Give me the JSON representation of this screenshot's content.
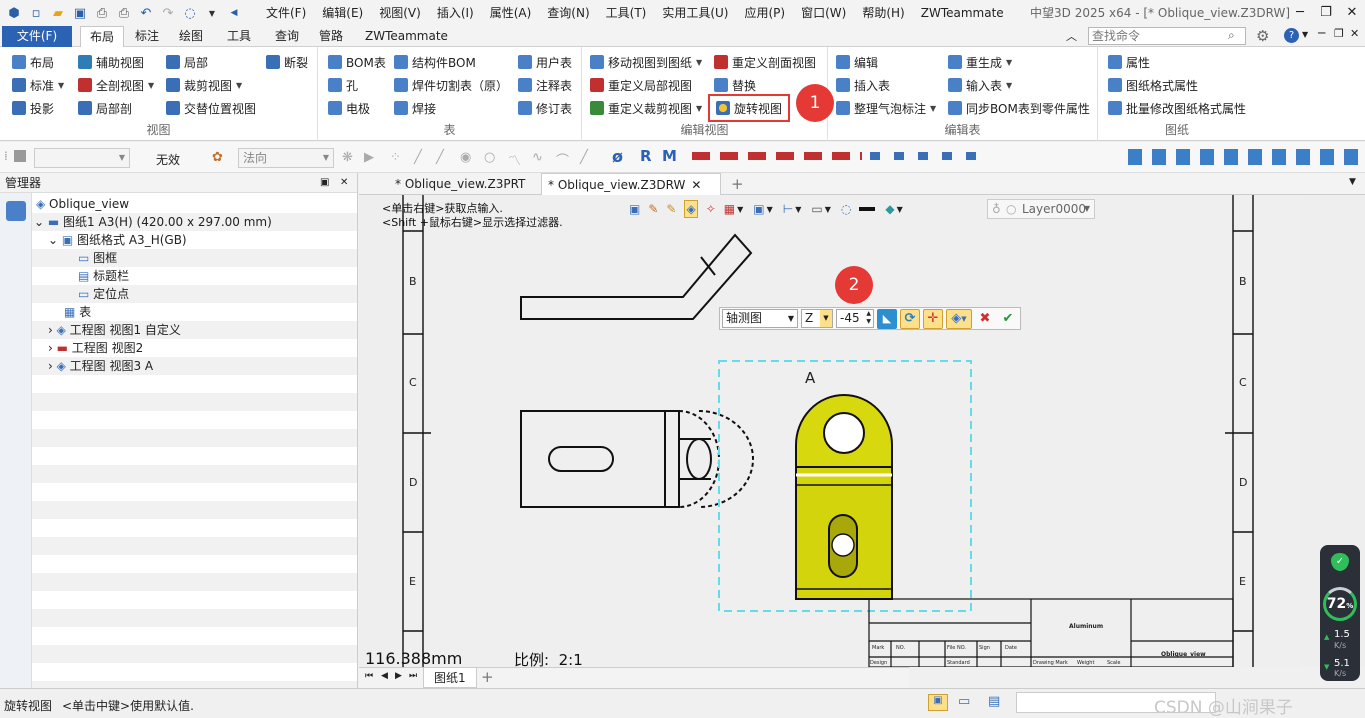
{
  "title_bar": {
    "menus": [
      "文件(F)",
      "编辑(E)",
      "视图(V)",
      "插入(I)",
      "属性(A)",
      "查询(N)",
      "工具(T)",
      "实用工具(U)",
      "应用(P)",
      "窗口(W)",
      "帮助(H)",
      "ZWTeammate"
    ],
    "title": "中望3D 2025 x64 - [* Oblique_view.Z3DRW]"
  },
  "ribbon_tabs": {
    "file": "文件(F)",
    "tabs": [
      "布局",
      "标注",
      "绘图",
      "工具",
      "查询",
      "管路",
      "ZWTeammate"
    ],
    "active": "布局",
    "search_placeholder": "查找命令"
  },
  "ribbon": {
    "view": {
      "name": "视图",
      "col1": [
        "布局",
        "标准",
        "投影"
      ],
      "col2": [
        "辅助视图",
        "全剖视图",
        "局部剖"
      ],
      "col3": [
        "局部",
        "裁剪视图",
        "交替位置视图"
      ],
      "col4": [
        "断裂"
      ]
    },
    "table": {
      "name": "表",
      "col1": [
        "BOM表",
        "孔",
        "电极"
      ],
      "col2": [
        "结构件BOM",
        "焊件切割表（原）",
        "焊接"
      ],
      "col3": [
        "用户表",
        "注释表",
        "修订表"
      ]
    },
    "edit_view": {
      "name": "编辑视图",
      "col1": [
        "移动视图到图纸",
        "重定义局部视图",
        "重定义裁剪视图"
      ],
      "col2": [
        "重定义剖面视图",
        "替换",
        "旋转视图"
      ]
    },
    "edit_table": {
      "name": "编辑表",
      "col1": [
        "编辑",
        "插入表",
        "整理气泡标注"
      ],
      "col2": [
        "重生成",
        "输入表",
        "同步BOM表到零件属性"
      ]
    },
    "sheet": {
      "name": "图纸",
      "items": [
        "属性",
        "图纸格式属性",
        "批量修改图纸格式属性"
      ]
    }
  },
  "toolbar2": {
    "invalid": "无效",
    "normal": "法向",
    "tools": [
      "ø",
      "R",
      "M"
    ]
  },
  "manager": {
    "title": "管理器",
    "tree": [
      "Oblique_view",
      "图纸1 A3(H) (420.00 x 297.00 mm)",
      "图纸格式 A3_H(GB)",
      "图框",
      "标题栏",
      "定位点",
      "表",
      "工程图 视图1 自定义",
      "工程图 视图2",
      "工程图 视图3 A"
    ]
  },
  "doc_tabs": [
    "* Oblique_view.Z3PRT",
    "* Oblique_view.Z3DRW"
  ],
  "canvas": {
    "hint1": "<单击右键>获取点输入.",
    "hint2": "<Shift +鼠标右键>显示选择过滤器.",
    "layer": "Layer0000",
    "border_left": [
      "B",
      "C",
      "D",
      "E"
    ],
    "border_right": [
      "B",
      "C",
      "D",
      "E"
    ],
    "view_label": "A",
    "coord": "116.388mm",
    "scale_label": "比例:",
    "scale_value": "2:1",
    "title_block": {
      "material": "Aluminum",
      "file_name": "Oblique_view",
      "headers": [
        "Mark",
        "NO.",
        "File NO.",
        "Sign",
        "Date"
      ],
      "row2": [
        "Design",
        "Standard",
        "Drawing Mark",
        "Weight",
        "Scale"
      ]
    }
  },
  "float_bar": {
    "view_type": "轴测图",
    "axis": "Z",
    "angle": "-45"
  },
  "callouts": [
    "1",
    "2"
  ],
  "sheet_tab": "图纸1",
  "status_bar": {
    "command": "旋转视图",
    "hint": "<单击中键>使用默认值."
  },
  "net_widget": {
    "percent": "72",
    "percent_unit": "%",
    "up": "1.5",
    "down": "5.1",
    "unit": "K/s"
  },
  "watermark": "CSDN @山涧果子",
  "colors": {
    "accent": "#2b62b3",
    "highlight_part": "#d4d40c",
    "callout": "#e53935",
    "selection_box": "#63dbe8"
  }
}
